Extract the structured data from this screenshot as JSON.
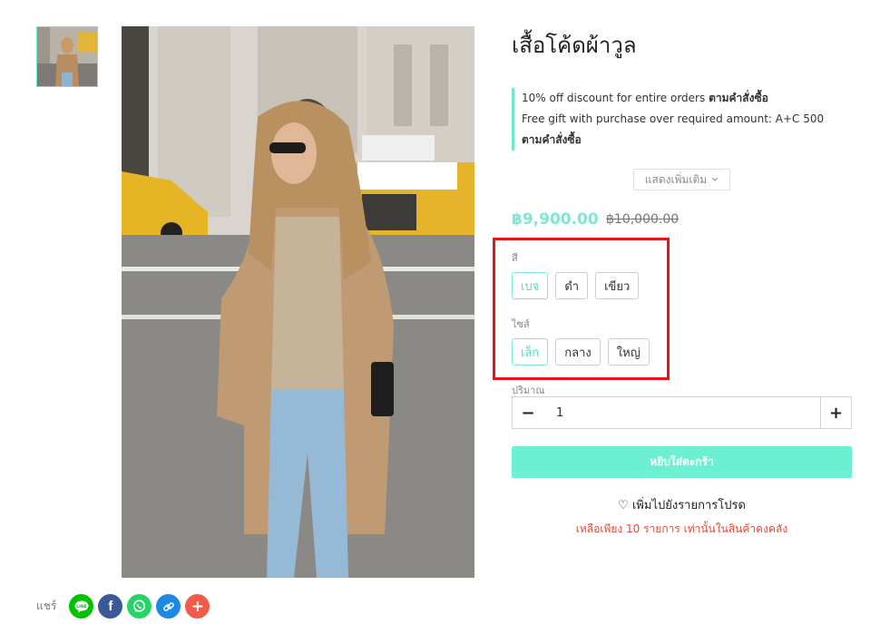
{
  "product": {
    "title": "เสื้อโค้ดผ้าวูล",
    "images": {
      "thumbnail_alt": "product-thumbnail",
      "main_alt": "product-main-photo"
    }
  },
  "promotions": [
    {
      "text": "10% off discount for entire orders ",
      "link": "ตามคำสั่งซื้อ"
    },
    {
      "text": "Free gift with purchase over required amount: A+C 500 ",
      "link": "ตามคำสั่งซื้อ"
    }
  ],
  "show_more_label": "แสดงเพิ่มเติม",
  "price": {
    "current": "฿9,900.00",
    "original": "฿10,000.00"
  },
  "color_option": {
    "label": "สี",
    "values": [
      "เบจ",
      "ดำ",
      "เขียว"
    ],
    "selected": "เบจ"
  },
  "size_option": {
    "label": "ไซส์",
    "values": [
      "เล็ก",
      "กลาง",
      "ใหญ่"
    ],
    "selected": "เล็ก"
  },
  "quantity": {
    "label": "ปริมาณ",
    "value": "1",
    "minus": "−",
    "plus": "+"
  },
  "add_to_cart_label": "หยิบใส่ตะกร้า",
  "wishlist_label": "♡ เพิ่มไปยังรายการโปรด",
  "stock_notice": "เหลือเพียง 10 รายการ เท่านั้นในสินค้าคงคลัง",
  "share": {
    "label": "แชร์",
    "buttons": [
      {
        "name": "line-icon",
        "color": "#00c300",
        "glyph": "LINE"
      },
      {
        "name": "facebook-icon",
        "color": "#3b5998",
        "glyph": "f"
      },
      {
        "name": "whatsapp-icon",
        "color": "#25d366",
        "glyph": ""
      },
      {
        "name": "link-icon",
        "color": "#1e88e5",
        "glyph": ""
      },
      {
        "name": "plus-icon",
        "color": "#f25a4a",
        "glyph": "+"
      }
    ]
  },
  "colors": {
    "accent": "#6cf0d2",
    "price": "#7be8d4",
    "highlight_box": "#e5141a",
    "stock_notice": "#e04a3a"
  }
}
